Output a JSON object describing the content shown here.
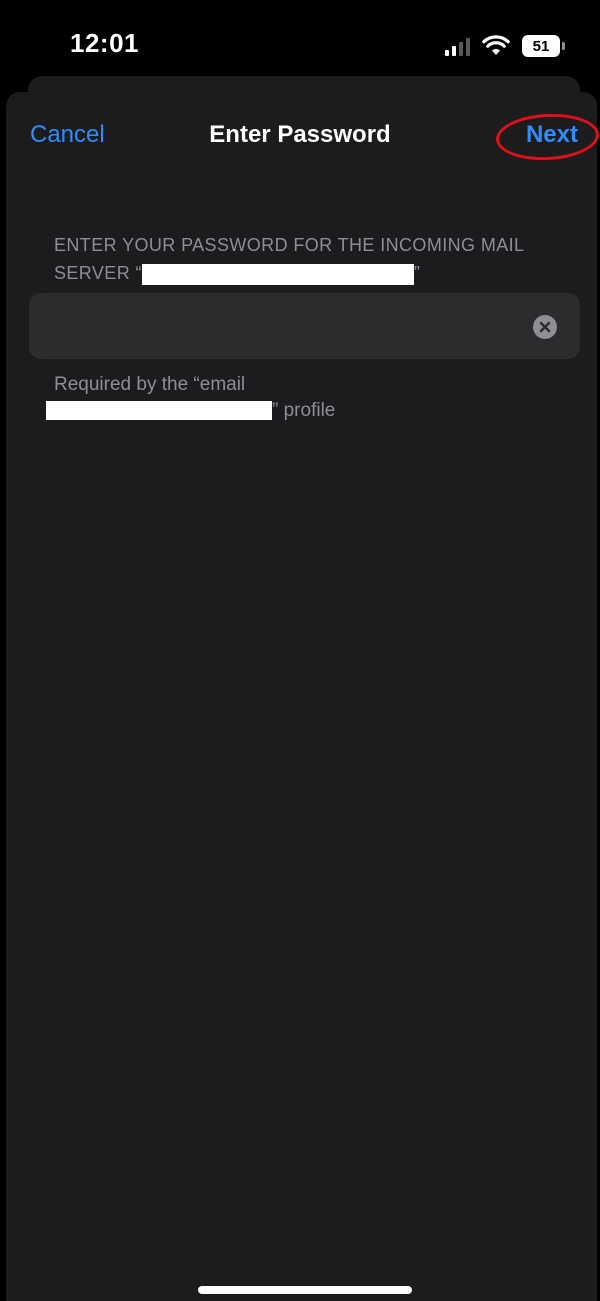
{
  "status_bar": {
    "time": "12:01",
    "battery": "51"
  },
  "nav": {
    "cancel_label": "Cancel",
    "title": "Enter Password",
    "next_label": "Next"
  },
  "password_section": {
    "header_line1": "ENTER YOUR PASSWORD FOR THE INCOMING MAIL",
    "header_line2_prefix": "SERVER “",
    "header_line2_suffix": "”",
    "field_value": "",
    "footer_line1": "Required by the “email",
    "footer_line2_suffix": "” profile"
  },
  "colors": {
    "accent": "#2f8df9",
    "background": "#1c1c1e",
    "field": "#2c2c2e",
    "secondary_text": "#8e8e93",
    "annotation": "#e0101b"
  },
  "icons": {
    "clear": "clear-x-circle-icon",
    "signal": "cellular-signal-icon",
    "wifi": "wifi-icon",
    "battery": "battery-icon"
  }
}
